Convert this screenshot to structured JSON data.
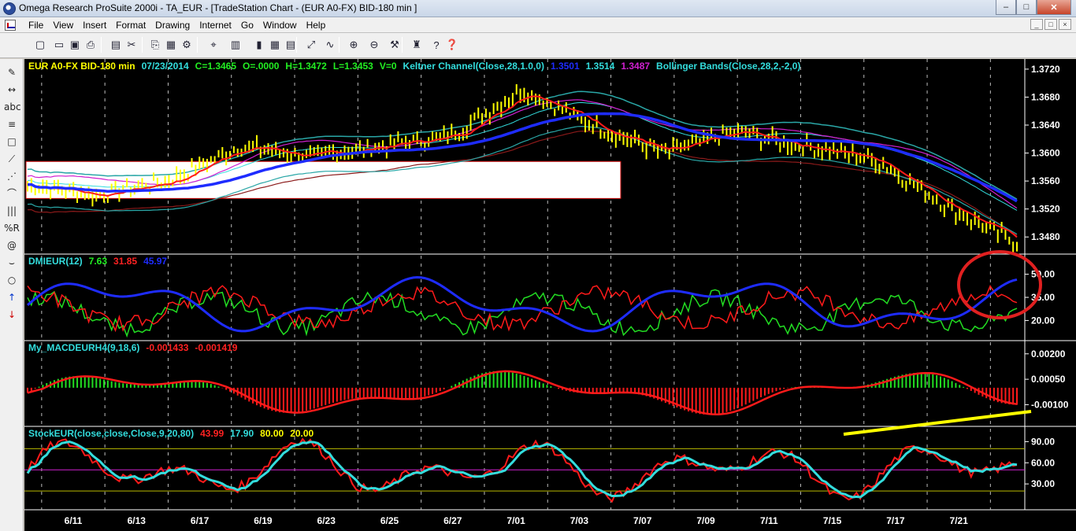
{
  "window": {
    "title": "Omega Research ProSuite 2000i - TA_EUR - [TradeStation Chart - (EUR A0-FX)  BID-180 min ]",
    "minimize": "–",
    "maximize": "□",
    "close": "✕"
  },
  "menu": [
    "File",
    "View",
    "Insert",
    "Format",
    "Drawing",
    "Internet",
    "Go",
    "Window",
    "Help"
  ],
  "mdi_buttons": [
    "_",
    "□",
    "×"
  ],
  "toolbar_icons": [
    "new-icon",
    "open-icon",
    "save-icon",
    "print-icon",
    "print-preview-icon",
    "cut-icon",
    "copy-icon",
    "paste-icon",
    "chart-properties-icon",
    "symbol-icon",
    "bar-chart-icon",
    "candle-icon",
    "grid-icon",
    "data-window-icon",
    "expand-icon",
    "indicators-icon",
    "zoom-in-icon",
    "zoom-out-icon",
    "tools-icon",
    "strategy-icon",
    "help-icon",
    "about-icon"
  ],
  "left_tools": [
    "pencil-icon",
    "horizontal-line-icon",
    "text-icon",
    "parallel-lines-icon",
    "rectangle-icon",
    "fibonacci-icon",
    "trendline-icon",
    "arc-icon",
    "speedlines-icon",
    "percent-retracement-icon",
    "spiral-icon",
    "curve-icon",
    "ellipse-icon",
    "buy-arrow-icon",
    "sell-arrow-icon"
  ],
  "left_tool_glyphs": [
    "✎",
    "↔",
    "abc",
    "≡",
    "□",
    "⟋",
    "⋰",
    "⌒",
    "|||",
    "%R",
    "@",
    "⌣",
    "○",
    "↑",
    "↓"
  ],
  "colors": {
    "background": "#000000",
    "price_bars": "#ffff00",
    "keltner": "#2aa7a7",
    "bollinger": "#d020d0",
    "avg_blue": "#1e2cff",
    "red": "#ff1a1a",
    "green": "#22dd22",
    "cyan": "#33dddd",
    "annotation_circle": "#e02020",
    "annotation_line": "#ffff00"
  },
  "panes": {
    "price": {
      "header": [
        "EUR A0-FX BID-180 min",
        "07/23/2014",
        "C=1.3465",
        "O=.0000",
        "H=1.3472",
        "L=1.3453",
        "V=0",
        "Keltner Channel(Close,28,1.0,0)",
        "1.3501",
        "1.3514",
        "1.3487",
        "Bollinger Bands(Close,28,2,-2,0)"
      ],
      "header_colors": [
        "#ffff00",
        "#33dddd",
        "#22ee22",
        "#22ee22",
        "#22ee22",
        "#22ee22",
        "#22ee22",
        "#33dddd",
        "#1e2cff",
        "#33dddd",
        "#d020d0",
        "#33dddd"
      ],
      "ticks": [
        "1.3720",
        "1.3680",
        "1.3640",
        "1.3600",
        "1.3560",
        "1.3520",
        "1.3480"
      ]
    },
    "dmi": {
      "header": [
        "DMIEUR(12)",
        "7.63",
        "31.85",
        "45.97"
      ],
      "header_colors": [
        "#33dddd",
        "#22ee22",
        "#ff2222",
        "#1e2cff"
      ],
      "ticks": [
        "50.00",
        "35.00",
        "20.00"
      ]
    },
    "macd": {
      "header": [
        "My_MACDEURH4(9,18,6)",
        "-0.001433",
        "-0.001419"
      ],
      "header_colors": [
        "#33dddd",
        "#ff2222",
        "#ff2222"
      ],
      "ticks": [
        "0.00200",
        "0.00050",
        "-0.00100"
      ]
    },
    "stoch": {
      "header": [
        "StockEUR(close,close,Close,9,20,80)",
        "43.99",
        "17.90",
        "80.00",
        "20.00"
      ],
      "header_colors": [
        "#33dddd",
        "#ff2222",
        "#33dddd",
        "#ffff00",
        "#ffff00"
      ],
      "ticks": [
        "90.00",
        "60.00",
        "30.00"
      ]
    }
  },
  "chart_data": {
    "type": "line",
    "x_dates": [
      "6/11",
      "6/13",
      "6/17",
      "6/19",
      "6/23",
      "6/25",
      "6/27",
      "7/01",
      "7/03",
      "7/07",
      "7/09",
      "7/11",
      "7/15",
      "7/17",
      "7/21"
    ],
    "price_close_approx": [
      1.3555,
      1.354,
      1.356,
      1.361,
      1.3595,
      1.361,
      1.3625,
      1.369,
      1.364,
      1.36,
      1.363,
      1.361,
      1.359,
      1.3525,
      1.347
    ],
    "price_range": [
      1.346,
      1.373
    ],
    "dmi_range": [
      10,
      60
    ],
    "macd_range": [
      -0.002,
      0.0025
    ],
    "stoch_range": [
      0,
      105
    ],
    "stoch_levels": [
      80,
      50,
      20
    ]
  }
}
